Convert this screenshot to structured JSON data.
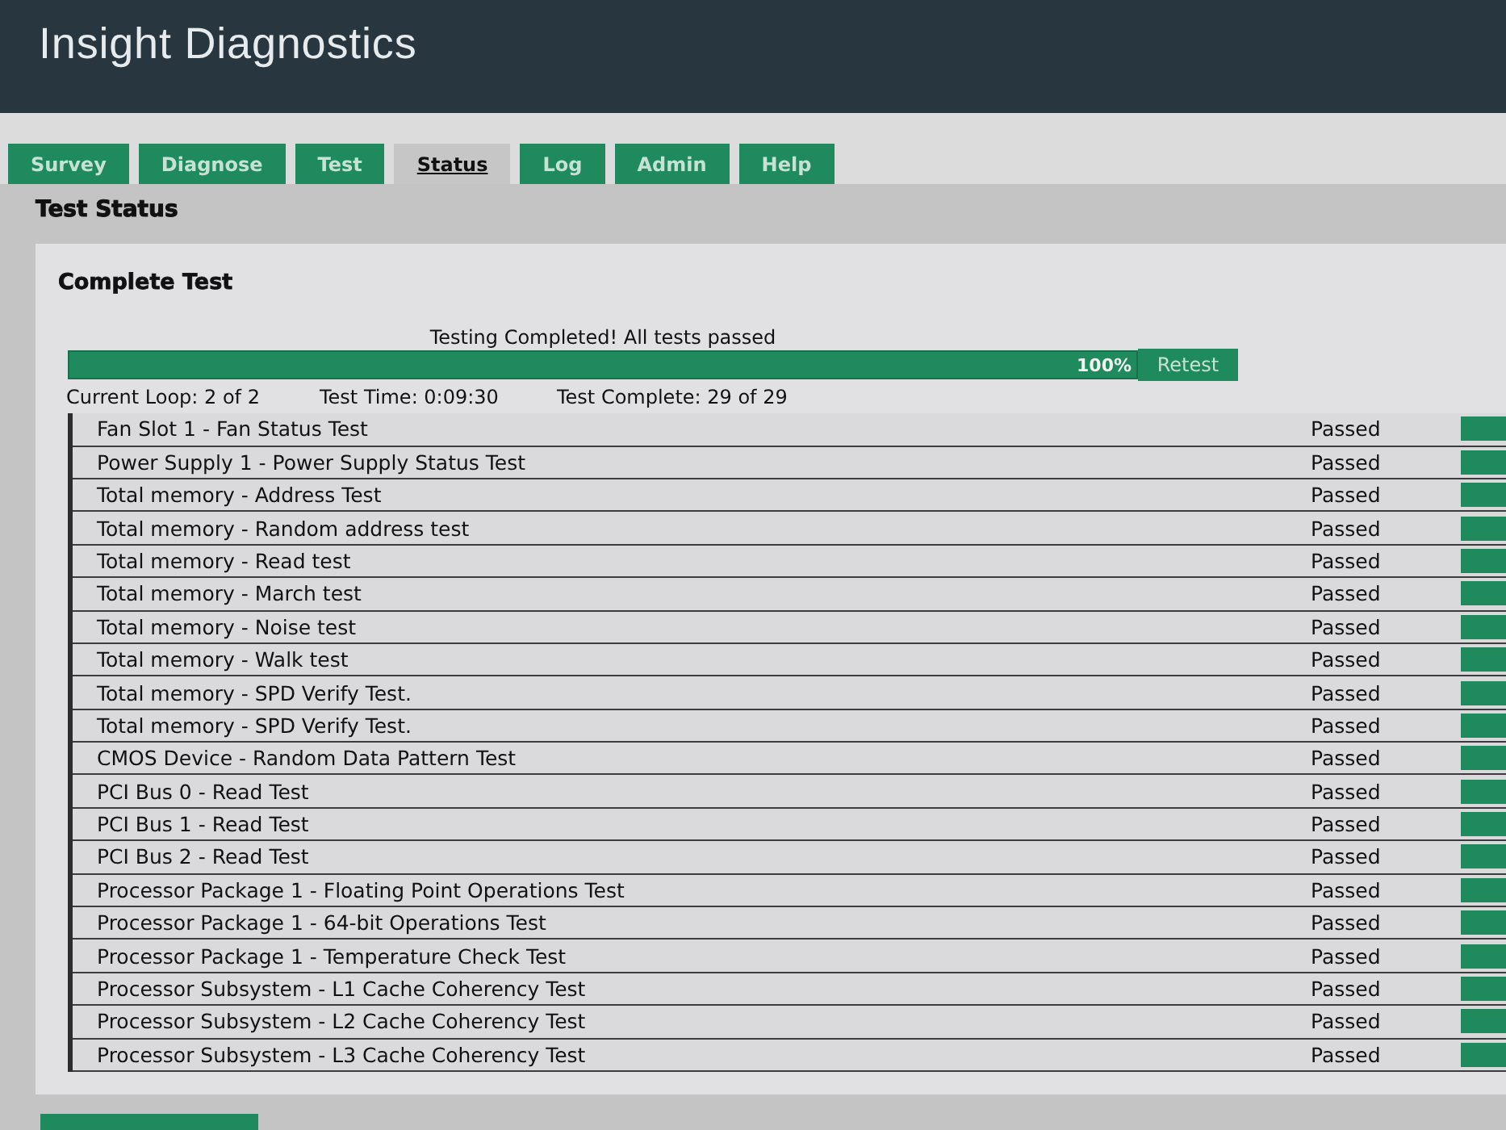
{
  "window": {
    "title": "Insight Diagnostics"
  },
  "tabs": [
    {
      "label": "Survey",
      "selected": false
    },
    {
      "label": "Diagnose",
      "selected": false
    },
    {
      "label": "Test",
      "selected": false
    },
    {
      "label": "Status",
      "selected": true
    },
    {
      "label": "Log",
      "selected": false
    },
    {
      "label": "Admin",
      "selected": false
    },
    {
      "label": "Help",
      "selected": false
    }
  ],
  "page_title": "Test Status",
  "panel": {
    "title": "Complete Test",
    "message": "Testing Completed! All tests passed",
    "progress": {
      "level": 1,
      "reading": "100%"
    },
    "retest_button": "Retest",
    "stats": [
      "Current Loop: 2 of 2",
      "Test Time: 0:09:30",
      "Test Complete: 29 of 29"
    ]
  },
  "results": [
    {
      "name": "Fan Slot 1 - Fan Status Test",
      "result": "Passed"
    },
    {
      "name": "Power Supply 1 - Power Supply Status Test",
      "result": "Passed"
    },
    {
      "name": "Total memory - Address Test",
      "result": "Passed"
    },
    {
      "name": "Total memory - Random address test",
      "result": "Passed"
    },
    {
      "name": "Total memory - Read test",
      "result": "Passed"
    },
    {
      "name": "Total memory - March test",
      "result": "Passed"
    },
    {
      "name": "Total memory - Noise test",
      "result": "Passed"
    },
    {
      "name": "Total memory - Walk test",
      "result": "Passed"
    },
    {
      "name": "Total memory - SPD Verify Test.",
      "result": "Passed"
    },
    {
      "name": "Total memory - SPD Verify Test.",
      "result": "Passed"
    },
    {
      "name": "CMOS Device - Random Data Pattern Test",
      "result": "Passed"
    },
    {
      "name": "PCI Bus 0 - Read Test",
      "result": "Passed"
    },
    {
      "name": "PCI Bus 1 - Read Test",
      "result": "Passed"
    },
    {
      "name": "PCI Bus 2 - Read Test",
      "result": "Passed"
    },
    {
      "name": "Processor Package 1 - Floating Point Operations Test",
      "result": "Passed"
    },
    {
      "name": "Processor Package 1 - 64-bit Operations Test",
      "result": "Passed"
    },
    {
      "name": "Processor Package 1 - Temperature Check Test",
      "result": "Passed"
    },
    {
      "name": "Processor Subsystem - L1 Cache Coherency Test",
      "result": "Passed"
    },
    {
      "name": "Processor Subsystem - L2 Cache Coherency Test",
      "result": "Passed"
    },
    {
      "name": "Processor Subsystem - L3 Cache Coherency Test",
      "result": "Passed"
    }
  ]
}
